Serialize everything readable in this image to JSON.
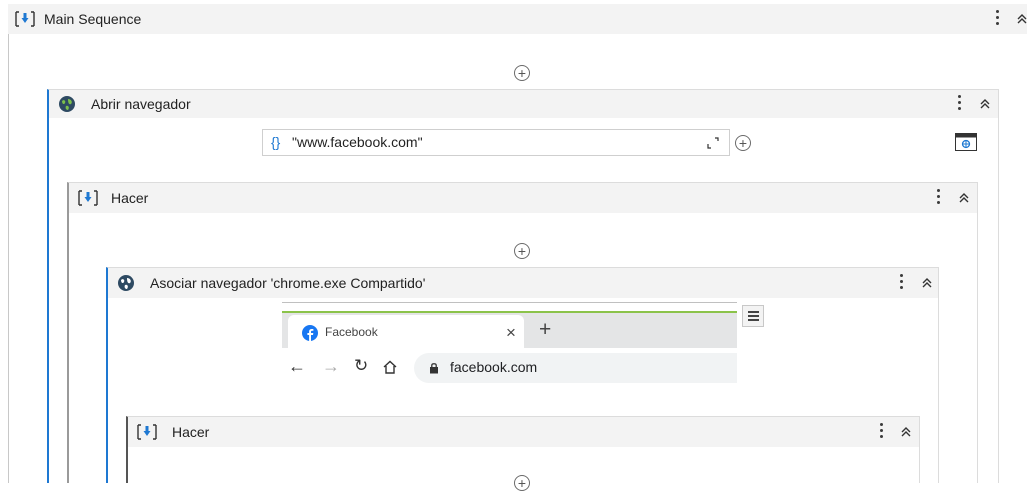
{
  "main_sequence": {
    "title": "Main Sequence"
  },
  "abrir_navegador": {
    "title": "Abrir navegador",
    "url_prefix_icon": "{}",
    "url_value": "\"www.facebook.com\""
  },
  "hacer_1": {
    "title": "Hacer"
  },
  "asociar_navegador": {
    "title": "Asociar navegador 'chrome.exe Compartido'",
    "preview": {
      "tab_label": "Facebook",
      "tab_close": "×",
      "new_tab": "+",
      "address": "facebook.com"
    }
  },
  "hacer_2": {
    "title": "Hacer"
  },
  "icons": {
    "sequence": "sequence-icon",
    "globe": "globe-icon",
    "more": "kebab-menu-icon",
    "collapse": "double-chevron-up-icon",
    "add": "plus-circle-icon",
    "expand": "expand-corner-icon",
    "browser_picker": "browser-window-icon",
    "hamburger": "hamburger-menu-icon",
    "facebook": "facebook-icon",
    "back": "back-arrow-icon",
    "forward": "forward-arrow-icon",
    "reload": "reload-icon",
    "home": "home-icon",
    "lock": "lock-icon"
  },
  "colors": {
    "accent_blue": "#1e78d2",
    "header_gray": "#f3f3f3",
    "border_gray": "#c8c8c8",
    "chrome_green": "#8bc34a",
    "facebook_blue": "#1877f2"
  }
}
